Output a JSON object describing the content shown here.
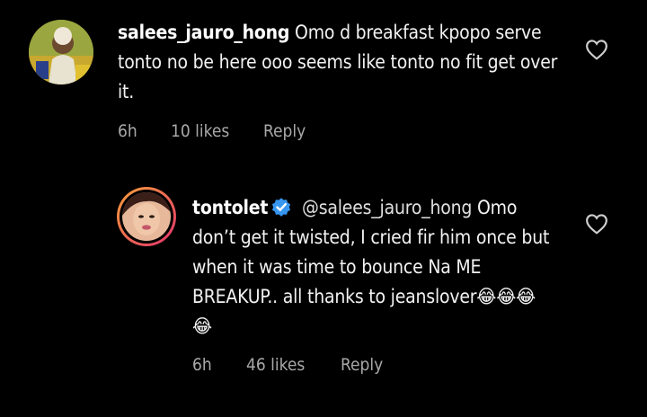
{
  "comments": [
    {
      "username": "salees_jauro_hong",
      "text": "Omo d breakfast kpopo serve tonto no be here ooo seems like tonto no fit get over it.",
      "time": "6h",
      "likes": "10 likes",
      "reply_label": "Reply"
    },
    {
      "username": "tontolet",
      "verified": true,
      "mention": "@salees_jauro_hong",
      "text": "Omo don’t get it twisted, I cried fir him once but when it was time to bounce Na ME BREAKUP.. all thanks to jeanslover😂😂😂😂",
      "time": "6h",
      "likes": "46 likes",
      "reply_label": "Reply"
    }
  ],
  "colors": {
    "background": "#000000",
    "text": "#f2f2f2",
    "meta": "#a8a8a8",
    "verified_badge": "#3797f0",
    "story_ring_start": "#f9a13a",
    "story_ring_end": "#e2336b"
  },
  "icons": [
    "heart-outline-icon",
    "verified-badge-icon"
  ]
}
